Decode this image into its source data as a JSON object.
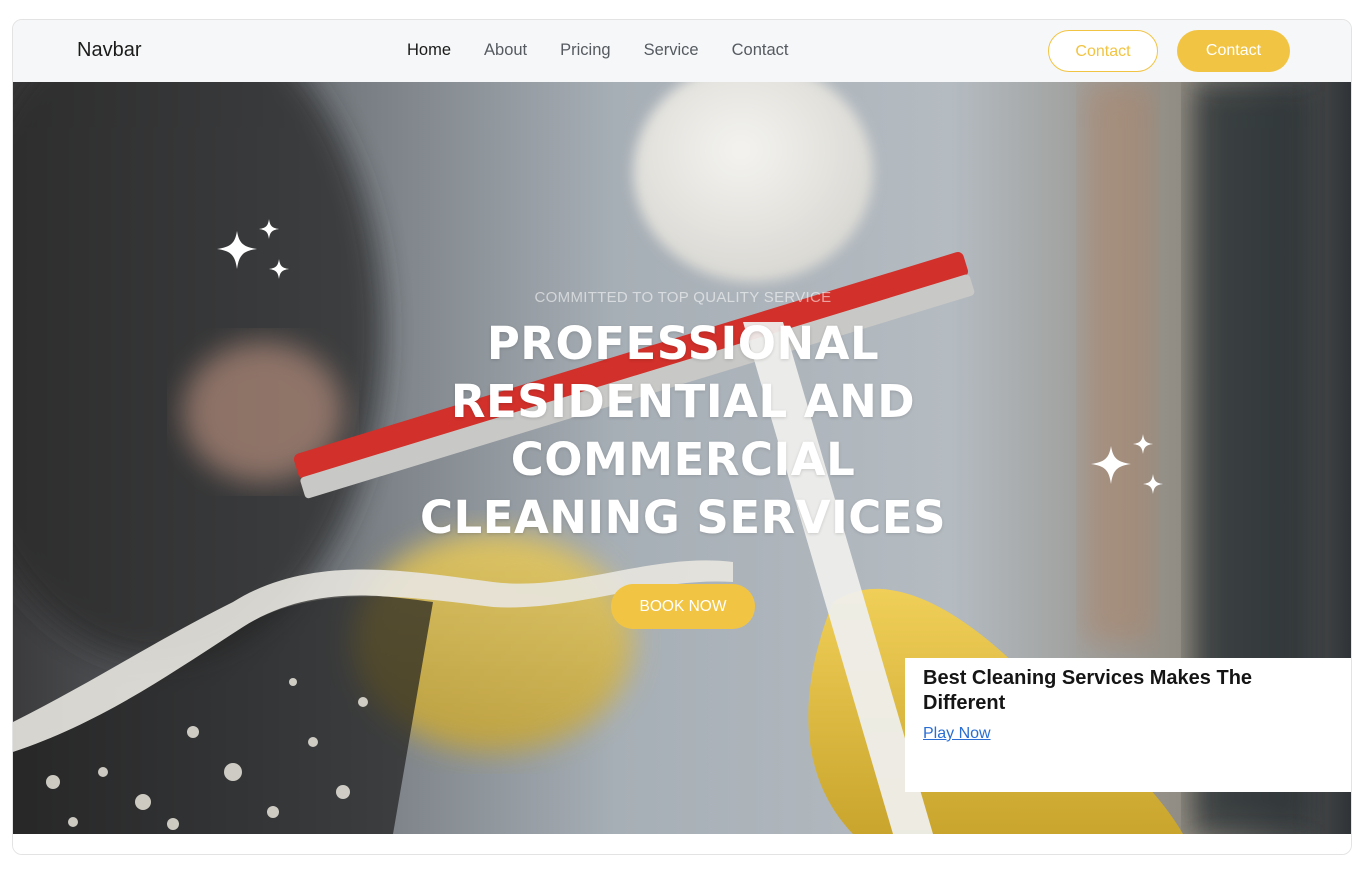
{
  "navbar": {
    "brand": "Navbar",
    "links": [
      "Home",
      "About",
      "Pricing",
      "Service",
      "Contact"
    ],
    "active": "Home",
    "contact_outline_label": "Contact",
    "contact_filled_label": "Contact"
  },
  "hero": {
    "subtitle": "COMMITTED TO TOP QUALITY SERVICE",
    "title": "PROFESSIONAL RESIDENTIAL AND COMMERCIAL CLEANING SERVICES",
    "cta_label": "BOOK NOW"
  },
  "promo": {
    "title": "Best Cleaning Services Makes The Different",
    "link_label": "Play Now"
  },
  "colors": {
    "accent": "#f2c443",
    "link": "#2a6ed4",
    "nav_bg": "#f6f7f8"
  },
  "icons": [
    "sparkle-icon"
  ]
}
